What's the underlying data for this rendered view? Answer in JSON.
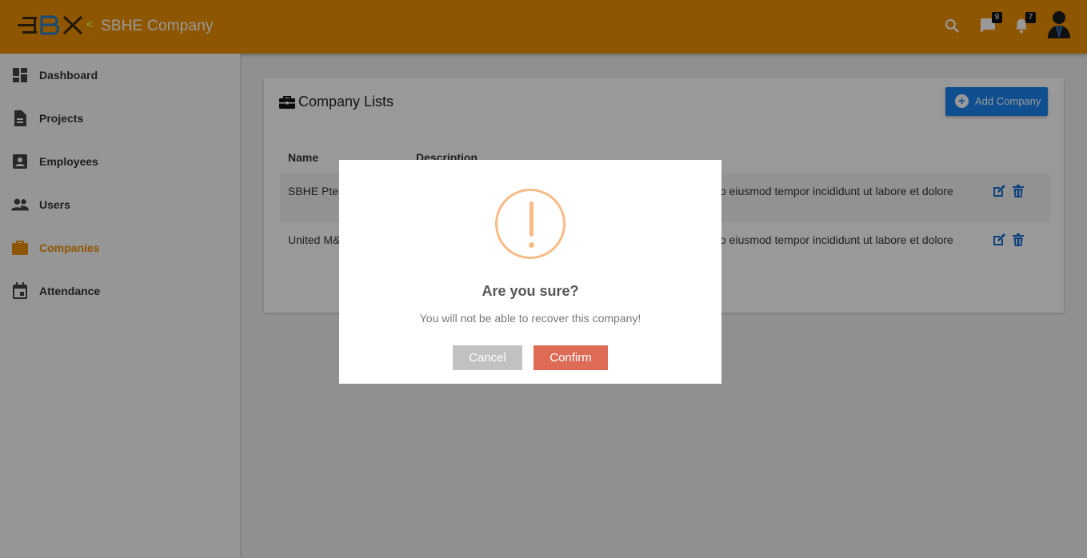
{
  "header": {
    "logo_text": "SBX",
    "company_name": "SBHE Company",
    "messages_count": "9",
    "notifications_count": "7"
  },
  "sidebar": {
    "items": [
      {
        "label": "Dashboard",
        "icon": "dashboard-icon"
      },
      {
        "label": "Projects",
        "icon": "document-icon"
      },
      {
        "label": "Employees",
        "icon": "badge-icon"
      },
      {
        "label": "Users",
        "icon": "people-icon"
      },
      {
        "label": "Companies",
        "icon": "briefcase-icon",
        "active": true
      },
      {
        "label": "Attendance",
        "icon": "calendar-icon"
      }
    ]
  },
  "main": {
    "title": "Company Lists",
    "add_button": "Add Company",
    "columns": [
      "Name",
      "Description"
    ],
    "rows": [
      {
        "name": "SBHE Pte",
        "description": "o eiusmod tempor incididunt ut labore et dolore"
      },
      {
        "name": "United M&",
        "description": "o eiusmod tempor incididunt ut labore et dolore"
      }
    ]
  },
  "modal": {
    "title": "Are you sure?",
    "text": "You will not be able to recover this company!",
    "cancel_label": "Cancel",
    "confirm_label": "Confirm"
  },
  "colors": {
    "brand": "#ee8f00",
    "primary_button": "#1a84f0",
    "confirm": "#dd6b55",
    "cancel": "#c1c1c1",
    "warning": "#f8bb86"
  }
}
